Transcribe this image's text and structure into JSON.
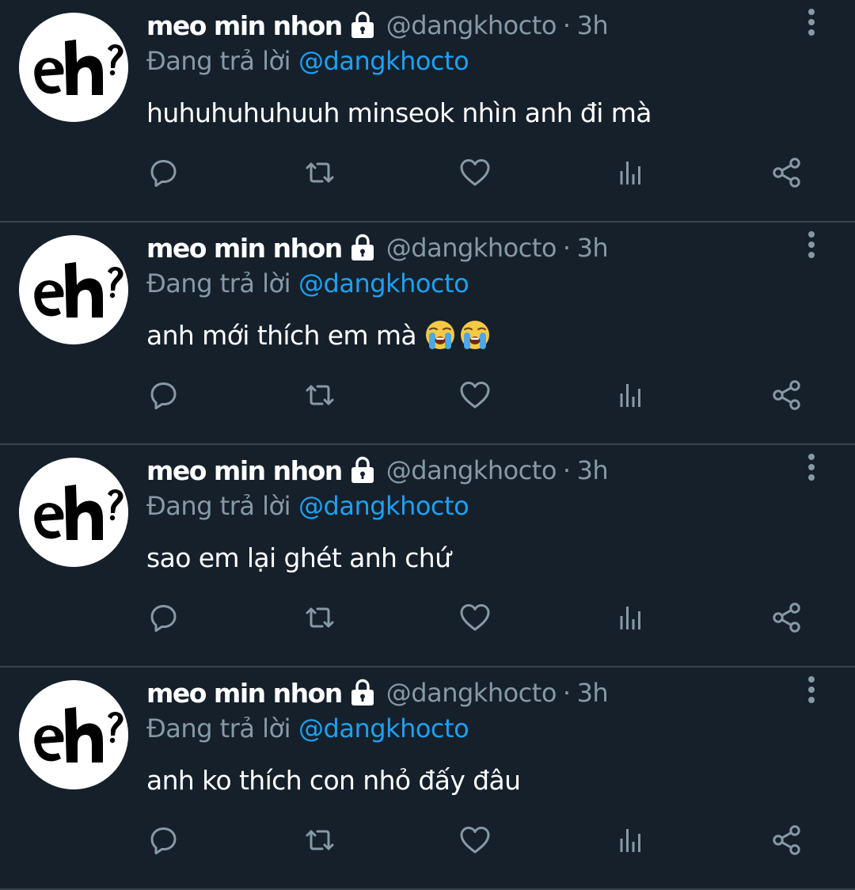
{
  "colors": {
    "background": "#15202b",
    "divider": "#38444d",
    "primary_text": "#ffffff",
    "secondary_text": "#8899a6",
    "mention": "#1da1f2"
  },
  "icons": {
    "verified_lock": "lock-icon",
    "more": "more-vertical-icon",
    "reply": "reply-icon",
    "retweet": "retweet-icon",
    "like": "heart-icon",
    "stats": "stats-icon",
    "share": "share-icon",
    "emoji": "loudly-crying-face-emoji"
  },
  "tweets": [
    {
      "display_name": "meo min nhon",
      "handle": "@dangkhocto",
      "separator": "·",
      "time": "3h",
      "reply_prefix": "Đang trả lời",
      "reply_to": "@dangkhocto",
      "text": "huhuhuhuhuuh minseok nhìn anh đi mà",
      "emoji_count": 0
    },
    {
      "display_name": "meo min nhon",
      "handle": "@dangkhocto",
      "separator": "·",
      "time": "3h",
      "reply_prefix": "Đang trả lời",
      "reply_to": "@dangkhocto",
      "text": "anh mới thích em mà",
      "emoji_count": 2
    },
    {
      "display_name": "meo min nhon",
      "handle": "@dangkhocto",
      "separator": "·",
      "time": "3h",
      "reply_prefix": "Đang trả lời",
      "reply_to": "@dangkhocto",
      "text": "sao em lại ghét anh chứ",
      "emoji_count": 0
    },
    {
      "display_name": "meo min nhon",
      "handle": "@dangkhocto",
      "separator": "·",
      "time": "3h",
      "reply_prefix": "Đang trả lời",
      "reply_to": "@dangkhocto",
      "text": "anh ko thích con nhỏ đấy đâu",
      "emoji_count": 0
    }
  ]
}
